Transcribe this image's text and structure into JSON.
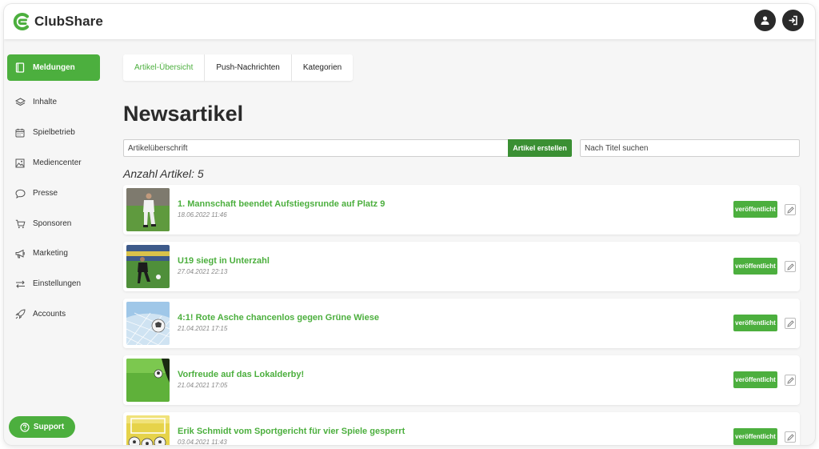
{
  "app": {
    "name": "ClubShare"
  },
  "header": {
    "profile_icon": "user-icon",
    "logout_icon": "logout-icon"
  },
  "sidebar": {
    "items": [
      {
        "label": "Meldungen",
        "icon": "book-icon",
        "active": true
      },
      {
        "label": "Inhalte",
        "icon": "layers-icon",
        "active": false
      },
      {
        "label": "Spielbetrieb",
        "icon": "calendar-icon",
        "active": false
      },
      {
        "label": "Mediencenter",
        "icon": "image-icon",
        "active": false
      },
      {
        "label": "Presse",
        "icon": "speech-bubble-icon",
        "active": false
      },
      {
        "label": "Sponsoren",
        "icon": "cart-icon",
        "active": false
      },
      {
        "label": "Marketing",
        "icon": "megaphone-icon",
        "active": false
      },
      {
        "label": "Einstellungen",
        "icon": "sliders-icon",
        "active": false
      },
      {
        "label": "Accounts",
        "icon": "rocket-icon",
        "active": false
      }
    ],
    "support_label": "Support"
  },
  "tabs": [
    {
      "label": "Artikel-Übersicht",
      "active": true
    },
    {
      "label": "Push-Nachrichten",
      "active": false
    },
    {
      "label": "Kategorien",
      "active": false
    }
  ],
  "page": {
    "title": "Newsartikel",
    "create_placeholder": "Artikelüberschrift",
    "create_button": "Artikel erstellen",
    "search_placeholder": "Nach Titel suchen",
    "count_label": "Anzahl Artikel: 5"
  },
  "articles": [
    {
      "title": "1. Mannschaft beendet Aufstiegsrunde auf Platz 9",
      "date": "18.06.2022 11:46",
      "status": "veröffentlicht"
    },
    {
      "title": "U19 siegt in Unterzahl",
      "date": "27.04.2021 22:13",
      "status": "veröffentlicht"
    },
    {
      "title": "4:1! Rote Asche chancenlos gegen Grüne Wiese",
      "date": "21.04.2021 17:15",
      "status": "veröffentlicht"
    },
    {
      "title": "Vorfreude auf das Lokalderby!",
      "date": "21.04.2021 17:05",
      "status": "veröffentlicht"
    },
    {
      "title": "Erik Schmidt vom Sportgericht für vier Spiele gesperrt",
      "date": "03.04.2021 11:43",
      "status": "veröffentlicht"
    }
  ],
  "colors": {
    "brand": "#4caf3e",
    "brand_dark": "#3a8f33",
    "dark": "#2a2a2a"
  }
}
